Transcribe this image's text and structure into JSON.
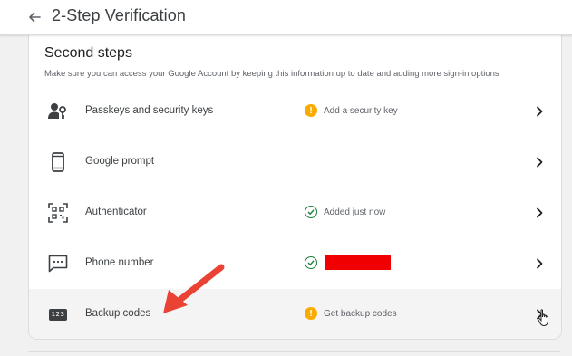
{
  "header": {
    "title": "2-Step Verification",
    "back_icon": "arrow-left-icon"
  },
  "section": {
    "title": "Second steps",
    "description": "Make sure you can access your Google Account by keeping this information up to date and adding more sign-in options"
  },
  "rows": [
    {
      "label": "Passkeys and security keys",
      "icon": "passkey-person-icon",
      "status": "warning",
      "status_text": "Add a security key"
    },
    {
      "label": "Google prompt",
      "icon": "phone-icon",
      "status": "none",
      "status_text": ""
    },
    {
      "label": "Authenticator",
      "icon": "qr-scan-icon",
      "status": "ok",
      "status_text": "Added just now"
    },
    {
      "label": "Phone number",
      "icon": "message-icon",
      "status": "redacted",
      "status_text": ""
    },
    {
      "label": "Backup codes",
      "icon": "123-badge-icon",
      "icon_text": "123",
      "status": "warning",
      "status_text": "Get backup codes"
    }
  ],
  "colors": {
    "warning": "#f9ab00",
    "ok": "#188038",
    "redaction": "#f00000",
    "annotation_arrow": "#ea4335"
  }
}
